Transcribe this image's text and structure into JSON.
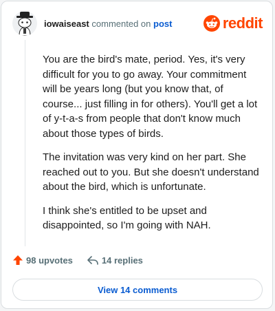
{
  "header": {
    "username": "iowaiseast",
    "action_text": "commented on",
    "target_link": "post",
    "brand_name": "reddit",
    "brand_color": "#ff4500"
  },
  "comment": {
    "paragraphs": [
      "You are the bird's mate, period. Yes, it's very difficult for you to go away. Your commitment will be years long (but you know that, of course... just filling in for others). You'll get a lot of y-t-a-s from people that don't know much about those types of birds.",
      "The invitation was very kind on her part. She reached out to you. But she doesn't understand about the bird, which is unfortunate.",
      "I think she's entitled to be upset and disappointed, so I'm going with NAH."
    ]
  },
  "actions": {
    "upvotes": "98 upvotes",
    "replies": "14 replies"
  },
  "view_comments": "View 14 comments",
  "icons": {
    "avatar": "snoo-avatar-icon",
    "brand": "reddit-logo-icon",
    "upvote": "upvote-arrow-icon",
    "reply": "reply-arrow-icon"
  }
}
